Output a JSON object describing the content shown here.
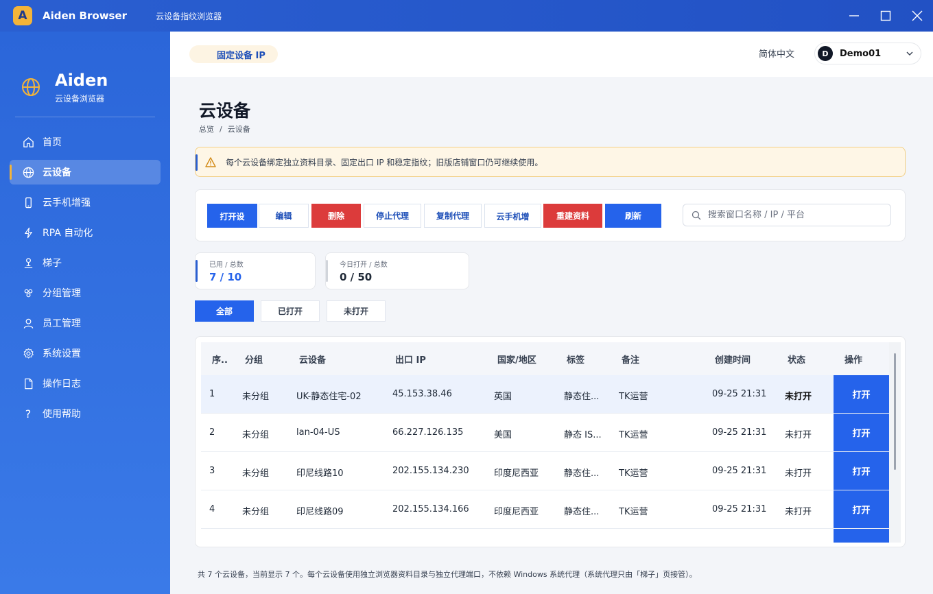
{
  "window": {
    "app_logo_letter": "A",
    "app_name": "Aiden Browser",
    "app_subtitle": "云设备指纹浏览器"
  },
  "sidebar": {
    "brand_name": "Aiden",
    "brand_sub": "云设备浏览器",
    "items": [
      {
        "label": "首页",
        "icon": "home-icon"
      },
      {
        "label": "云设备",
        "icon": "globe-icon",
        "active": true
      },
      {
        "label": "云手机增强",
        "icon": "phone-icon"
      },
      {
        "label": "RPA 自动化",
        "icon": "lightning-icon"
      },
      {
        "label": "梯子",
        "icon": "ladder-icon"
      },
      {
        "label": "分组管理",
        "icon": "group-icon"
      },
      {
        "label": "员工管理",
        "icon": "user-icon"
      },
      {
        "label": "系统设置",
        "icon": "gear-icon"
      },
      {
        "label": "操作日志",
        "icon": "document-icon"
      },
      {
        "label": "使用帮助",
        "icon": "help-icon"
      }
    ]
  },
  "header": {
    "ip_pill": "固定设备 IP",
    "language": "简体中文",
    "user_avatar": "D",
    "user_name": "Demo01"
  },
  "page": {
    "title": "云设备",
    "breadcrumb": [
      "总览",
      "云设备"
    ],
    "breadcrumb_sep": "/",
    "notice": "每个云设备绑定独立资料目录、固定出口 IP 和稳定指纹；旧版店铺窗口仍可继续使用。"
  },
  "toolbar": {
    "open": "打开设",
    "edit": "编辑",
    "delete": "删除",
    "stop_proxy": "停止代理",
    "copy_proxy": "复制代理",
    "cloud_phone": "云手机增",
    "rebuild": "重建资料",
    "refresh": "刷新",
    "search_placeholder": "搜索窗口名称 / IP / 平台"
  },
  "stats": {
    "used_label": "已用 / 总数",
    "used_value": "7 / 10",
    "today_label": "今日打开 / 总数",
    "today_value": "0 / 50"
  },
  "filters": {
    "all": "全部",
    "opened": "已打开",
    "closed": "未打开"
  },
  "table": {
    "headers": {
      "index": "序..",
      "group": "分组",
      "device": "云设备",
      "ip": "出口 IP",
      "country": "国家/地区",
      "tag": "标签",
      "note": "备注",
      "created": "创建时间",
      "status": "状态",
      "action": "操作"
    },
    "rows": [
      {
        "index": "1",
        "group": "未分组",
        "device": "UK-静态住宅-02",
        "ip": "45.153.38.46",
        "country": "英国",
        "tag": "静态住...",
        "note": "TK运营",
        "created": "09-25 21:31",
        "status": "未打开",
        "action": "打开"
      },
      {
        "index": "2",
        "group": "未分组",
        "device": "lan-04-US",
        "ip": "66.227.126.135",
        "country": "美国",
        "tag": "静态 IS...",
        "note": "TK运营",
        "created": "09-25 21:31",
        "status": "未打开",
        "action": "打开"
      },
      {
        "index": "3",
        "group": "未分组",
        "device": "印尼线路10",
        "ip": "202.155.134.230",
        "country": "印度尼西亚",
        "tag": "静态住...",
        "note": "TK运营",
        "created": "09-25 21:31",
        "status": "未打开",
        "action": "打开"
      },
      {
        "index": "4",
        "group": "未分组",
        "device": "印尼线路09",
        "ip": "202.155.134.166",
        "country": "印度尼西亚",
        "tag": "静态住...",
        "note": "TK运营",
        "created": "09-25 21:31",
        "status": "未打开",
        "action": "打开"
      }
    ]
  },
  "footer": "共 7 个云设备，当前显示 7 个。每个云设备使用独立浏览器资料目录与独立代理端口，不依赖 Windows 系统代理（系统代理只由「梯子」页接管）。",
  "colors": {
    "primary": "#2563eb",
    "danger": "#dc3b3b",
    "accent": "#f3b43a",
    "sidebar": "#2b66d9"
  }
}
